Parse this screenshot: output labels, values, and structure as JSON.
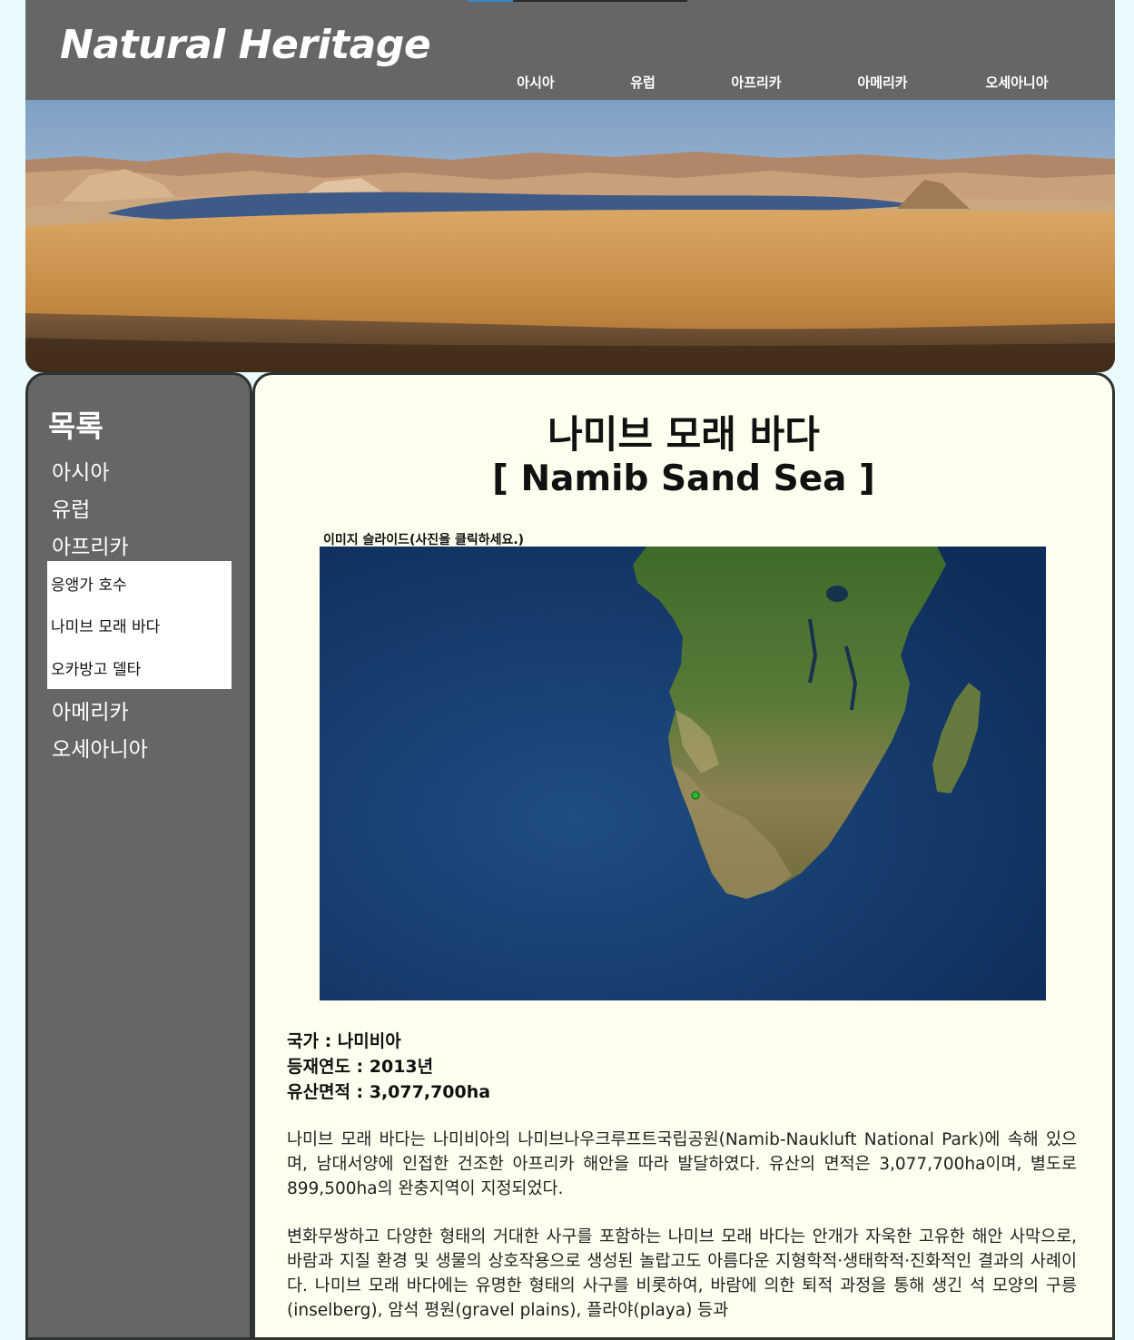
{
  "header": {
    "logo": "Natural Heritage",
    "nav": [
      "아시아",
      "유럽",
      "아프리카",
      "아메리카",
      "오세아니아"
    ]
  },
  "sidebar": {
    "title": "목록",
    "items": [
      "아시아",
      "유럽",
      "아프리카",
      "아메리카",
      "오세아니아"
    ],
    "submenu": [
      "응앵가 호수",
      "나미브 모래 바다",
      "오카방고 델타"
    ]
  },
  "main": {
    "title_ko": "나미브 모래 바다",
    "title_en": "[ Namib Sand Sea ]",
    "slide_caption": "이미지 슬라이드(사진을 클릭하세요.)",
    "facts": {
      "country": "국가 : 나미비아",
      "year": "등재연도 : 2013년",
      "area": "유산면적 : 3,077,700ha"
    },
    "paragraphs": [
      "나미브 모래 바다는 나미비아의 나미브나우크루프트국립공원(Namib-Naukluft National Park)에 속해 있으며, 남대서양에 인접한 건조한 아프리카 해안을 따라 발달하였다. 유산의 면적은 3,077,700ha이며, 별도로 899,500ha의 완충지역이 지정되었다.",
      "변화무쌍하고 다양한 형태의 거대한 사구를 포함하는 나미브 모래 바다는 안개가 자욱한 고유한 해안 사막으로, 바람과 지질 환경 및 생물의 상호작용으로 생성된 놀랍고도 아름다운 지형학적·생태학적·진화적인 결과의 사례이다. 나미브 모래 바다에는 유명한 형태의 사구를 비롯하여, 바람에 의한 퇴적 과정을 통해 생긴 석 모양의 구릉(inselberg), 암석 평원(gravel plains), 플라야(playa) 등과"
    ]
  },
  "colors": {
    "page_bg": "#e9fbfc",
    "header_bg": "#656665",
    "sidebar_bg": "#656665",
    "content_bg": "#fffff0",
    "border": "#2c3331",
    "map_marker": "#22c02a"
  }
}
